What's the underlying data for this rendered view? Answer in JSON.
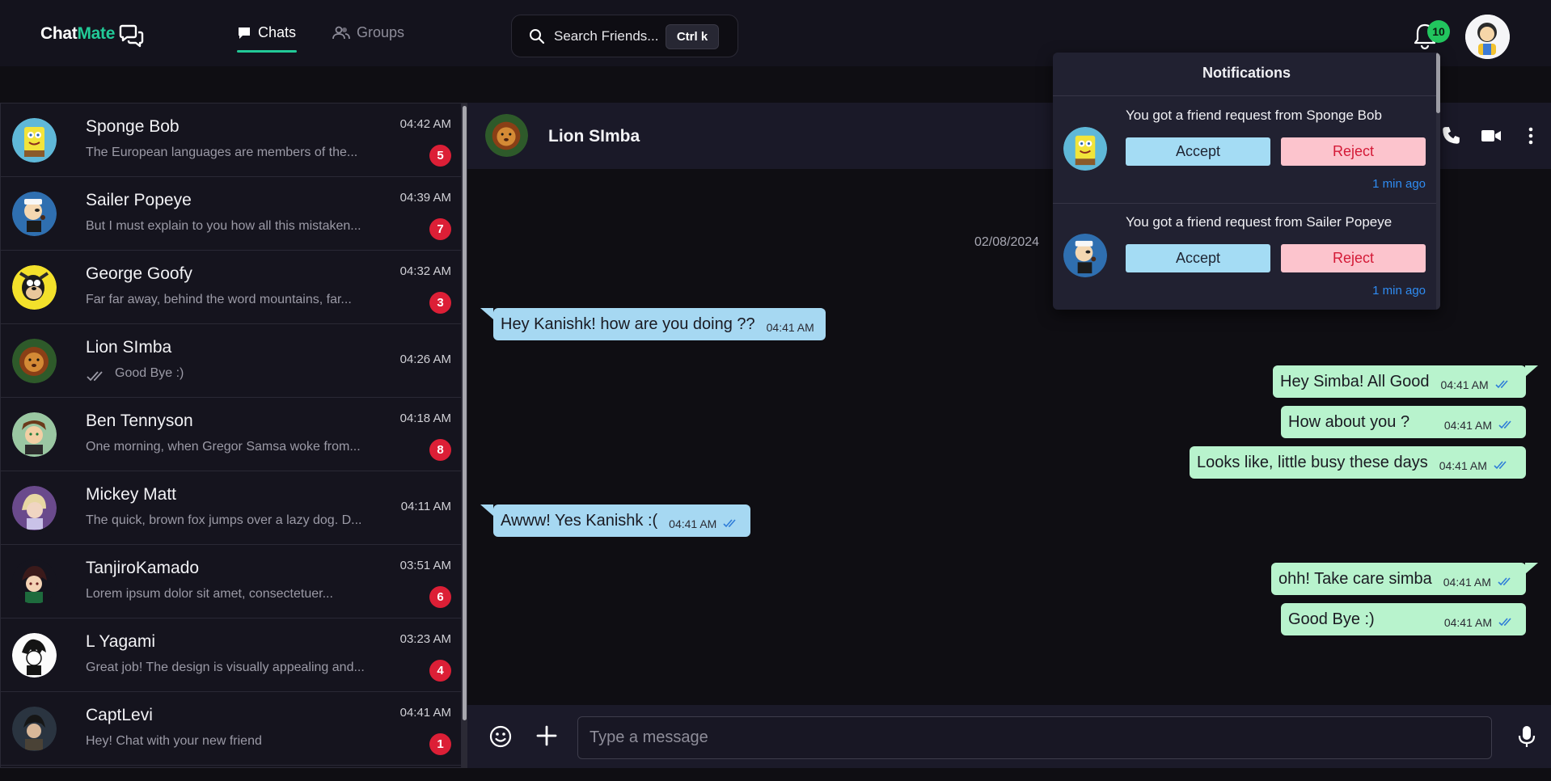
{
  "app": {
    "logo_part1": "Chat",
    "logo_part2": "Mate",
    "colors": {
      "accent": "#22c997",
      "unread": "#dc1f36",
      "incoming": "#a6d8f2",
      "outgoing": "#b8f3cd",
      "link": "#2f8cf2"
    }
  },
  "nav": {
    "tabs": [
      {
        "label": "Chats",
        "icon": "chat-bubble-icon",
        "active": true
      },
      {
        "label": "Groups",
        "icon": "users-icon",
        "active": false
      }
    ]
  },
  "search": {
    "label": "Search Friends...",
    "shortcut": "Ctrl k"
  },
  "header": {
    "notification_count": "10"
  },
  "chats": [
    {
      "name": "Sponge Bob",
      "preview": "The European languages are members of the...",
      "time": "04:42 AM",
      "unread": "5"
    },
    {
      "name": "Sailer Popeye",
      "preview": "But I must explain to you how all this mistaken...",
      "time": "04:39 AM",
      "unread": "7"
    },
    {
      "name": "George Goofy",
      "preview": "Far far away, behind the word mountains, far...",
      "time": "04:32 AM",
      "unread": "3"
    },
    {
      "name": "Lion SImba",
      "preview": "Good Bye :)",
      "time": "04:26 AM",
      "unread": ""
    },
    {
      "name": "Ben Tennyson",
      "preview": "One morning, when Gregor Samsa woke from...",
      "time": "04:18 AM",
      "unread": "8"
    },
    {
      "name": "Mickey Matt",
      "preview": "The quick, brown fox jumps over a lazy dog. D...",
      "time": "04:11 AM",
      "unread": ""
    },
    {
      "name": "TanjiroKamado",
      "preview": "Lorem ipsum dolor sit amet, consectetuer...",
      "time": "03:51 AM",
      "unread": "6"
    },
    {
      "name": "L Yagami",
      "preview": "Great job! The design is visually appealing and...",
      "time": "03:23 AM",
      "unread": "4"
    },
    {
      "name": "CaptLevi",
      "preview": "Hey! Chat with your new friend",
      "time": "04:41 AM",
      "unread": "1"
    }
  ],
  "conversation": {
    "name": "Lion SImba",
    "date": "02/08/2024",
    "messages": [
      {
        "text": "Hey Kanishk! how are you doing ??",
        "time": "04:41 AM",
        "dir": "in"
      },
      {
        "text": "Hey Simba! All Good",
        "time": "04:41 AM",
        "dir": "out"
      },
      {
        "text": "How about you ?",
        "time": "04:41 AM",
        "dir": "out"
      },
      {
        "text": "Looks like, little busy these days",
        "time": "04:41 AM",
        "dir": "out"
      },
      {
        "text": "Awww! Yes Kanishk :(",
        "time": "04:41 AM",
        "dir": "in"
      },
      {
        "text": "ohh! Take care simba",
        "time": "04:41 AM",
        "dir": "out"
      },
      {
        "text": "Good Bye :)",
        "time": "04:41 AM",
        "dir": "out"
      }
    ]
  },
  "composer": {
    "placeholder": "Type a message"
  },
  "notifications": {
    "title": "Notifications",
    "items": [
      {
        "text": "You got a friend request from Sponge Bob",
        "accept": "Accept",
        "reject": "Reject",
        "ago": "1 min ago"
      },
      {
        "text": "You got a friend request from Sailer Popeye",
        "accept": "Accept",
        "reject": "Reject",
        "ago": "1 min ago"
      }
    ]
  }
}
